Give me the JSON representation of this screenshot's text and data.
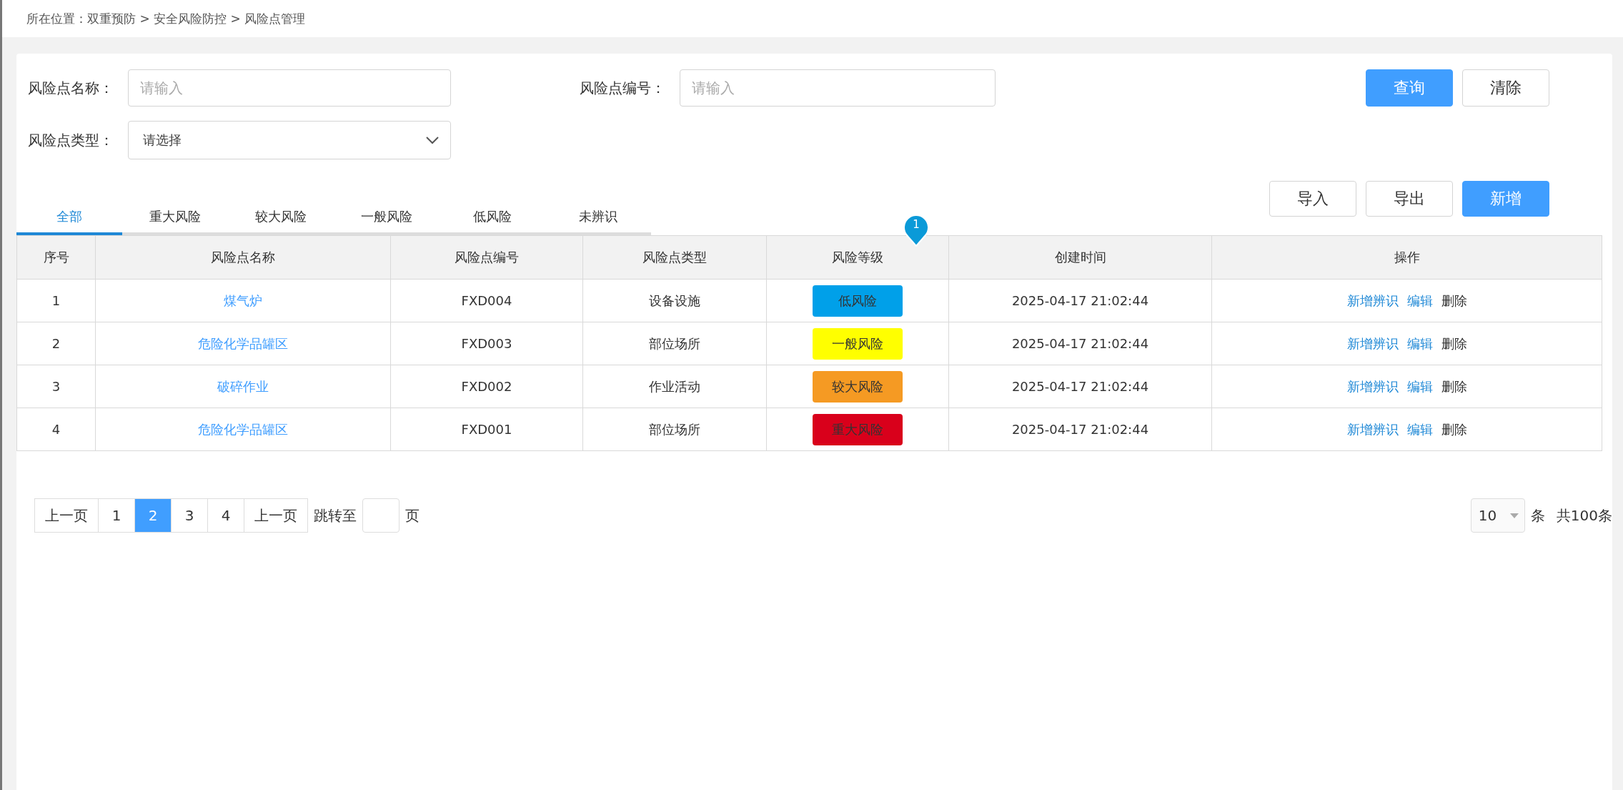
{
  "breadcrumb": "所在位置：双重预防 > 安全风险防控 > 风险点管理",
  "filters": [
    {
      "label": "风险点名称：",
      "kind": "input",
      "placeholder": "请输入"
    },
    {
      "label": "风险点编号：",
      "kind": "input",
      "placeholder": "请输入"
    },
    {
      "label": "风险点类型：",
      "kind": "select",
      "value": "请选择"
    }
  ],
  "filter_buttons": [
    {
      "label": "查询",
      "primary": true
    },
    {
      "label": "清除",
      "primary": false
    }
  ],
  "tabs": [
    {
      "label": "全部",
      "selected": true
    },
    {
      "label": "重大风险",
      "selected": false
    },
    {
      "label": "较大风险",
      "selected": false
    },
    {
      "label": "一般风险",
      "selected": false
    },
    {
      "label": "低风险",
      "selected": false
    },
    {
      "label": "未辨识",
      "selected": false
    }
  ],
  "action_buttons": [
    {
      "label": "导入",
      "primary": false
    },
    {
      "label": "导出",
      "primary": false
    },
    {
      "label": "新增",
      "primary": true
    }
  ],
  "marker": "1",
  "table": {
    "columns": [
      "序号",
      "风险点名称",
      "风险点编号",
      "风险点类型",
      "风险等级",
      "创建时间",
      "操作"
    ],
    "rows": [
      {
        "index": "1",
        "name": "煤气炉",
        "code": "FXD004",
        "type": "设备设施",
        "level": "低风险",
        "color": "#00a0e9",
        "created": "2025-04-17 21:02:44",
        "actions": [
          {
            "label": "新增辨识",
            "kind": "link"
          },
          {
            "label": "编辑",
            "kind": "link"
          },
          {
            "label": "删除",
            "kind": "plain"
          }
        ]
      },
      {
        "index": "2",
        "name": "危险化学品罐区",
        "code": "FXD003",
        "type": "部位场所",
        "level": "一般风险",
        "color": "#ffff00",
        "created": "2025-04-17 21:02:44",
        "actions": [
          {
            "label": "新增辨识",
            "kind": "link"
          },
          {
            "label": "编辑",
            "kind": "link"
          },
          {
            "label": "删除",
            "kind": "plain"
          }
        ]
      },
      {
        "index": "3",
        "name": "破碎作业",
        "code": "FXD002",
        "type": "作业活动",
        "level": "较大风险",
        "color": "#f59a23",
        "created": "2025-04-17 21:02:44",
        "actions": [
          {
            "label": "新增辨识",
            "kind": "link"
          },
          {
            "label": "编辑",
            "kind": "link"
          },
          {
            "label": "删除",
            "kind": "plain"
          }
        ]
      },
      {
        "index": "4",
        "name": "危险化学品罐区",
        "code": "FXD001",
        "type": "部位场所",
        "level": "重大风险",
        "color": "#d9001b",
        "created": "2025-04-17 21:02:44",
        "actions": [
          {
            "label": "新增辨识",
            "kind": "link"
          },
          {
            "label": "编辑",
            "kind": "link"
          },
          {
            "label": "删除",
            "kind": "plain"
          }
        ]
      }
    ]
  },
  "pagination": {
    "prev": "上一页",
    "pages": [
      {
        "label": "1",
        "selected": false
      },
      {
        "label": "2",
        "selected": true
      },
      {
        "label": "3",
        "selected": false
      },
      {
        "label": "4",
        "selected": false
      }
    ],
    "next": "上一页",
    "jump_label": "跳转至",
    "jump_suffix": "页",
    "page_size": "10",
    "page_size_unit": "条",
    "total": "共100条"
  }
}
